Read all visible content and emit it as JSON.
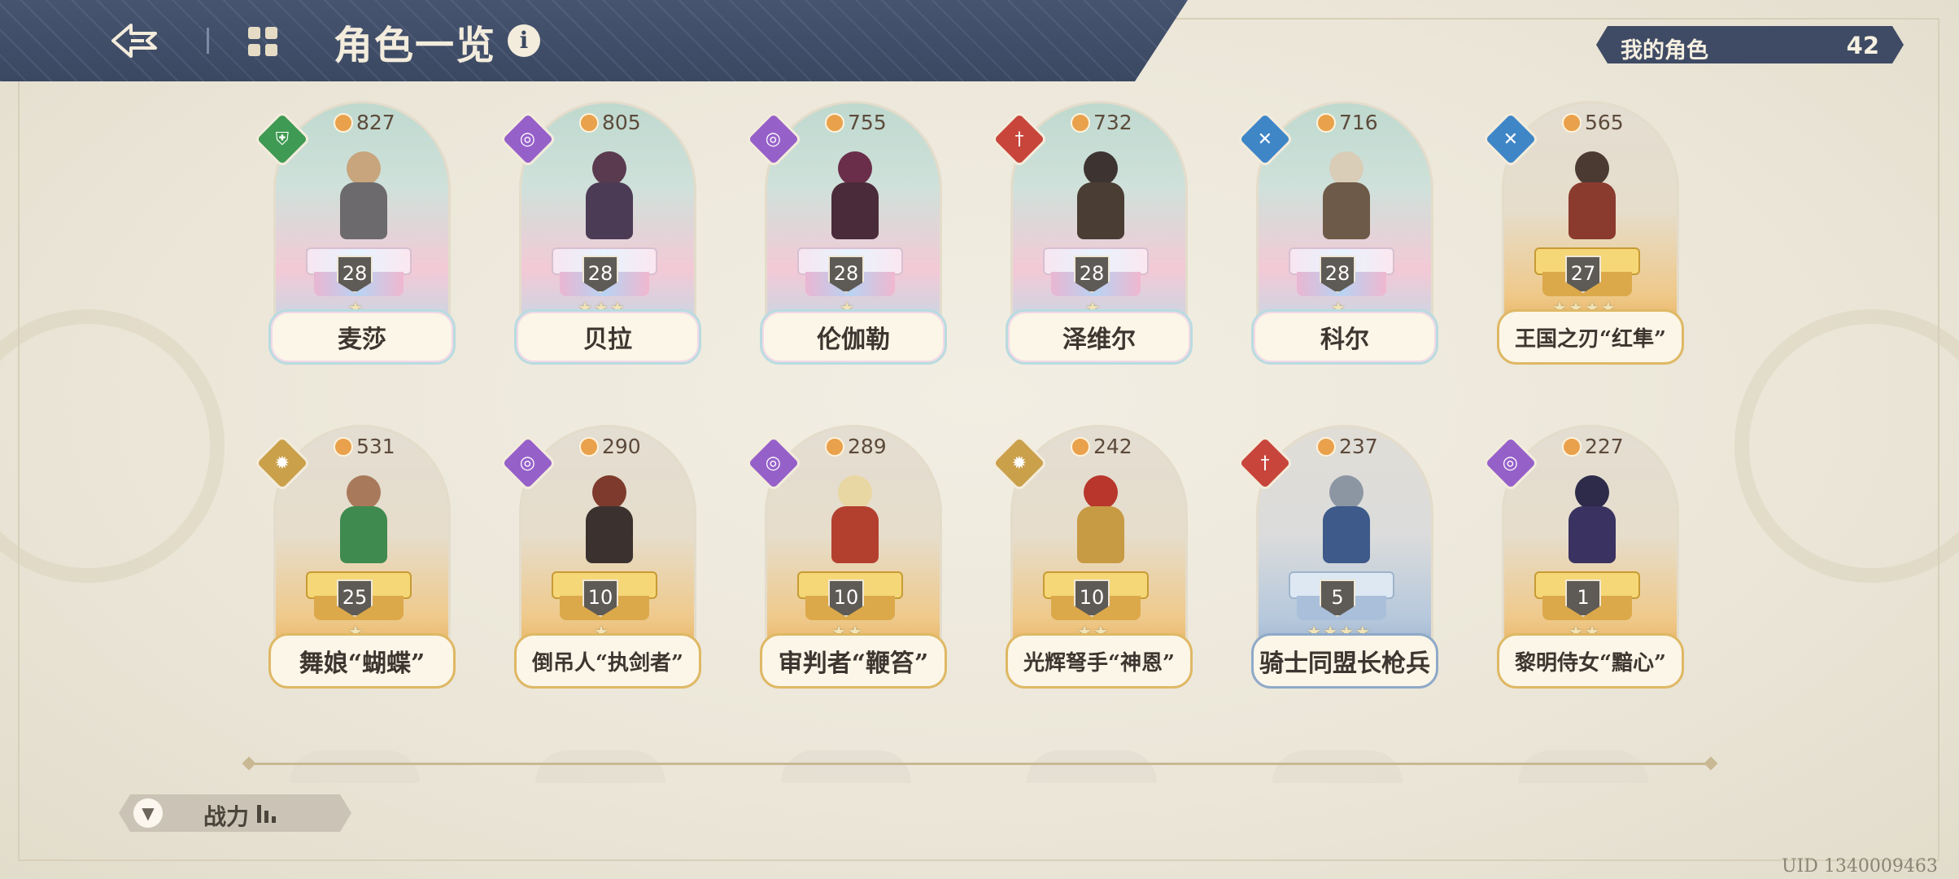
{
  "header": {
    "title": "角色一览",
    "back_icon": "back-arrow-icon",
    "grid_icon": "grid-view-icon",
    "info_icon": "info-icon"
  },
  "my_characters": {
    "label": "我的角色",
    "count": "42"
  },
  "characters": [
    {
      "name": "麦莎",
      "power": "827",
      "level": "28",
      "stars": "★",
      "element": "green-shield",
      "frame": "rainbow"
    },
    {
      "name": "贝拉",
      "power": "805",
      "level": "28",
      "stars": "★★★",
      "element": "purple-spiral",
      "frame": "rainbow"
    },
    {
      "name": "伦伽勒",
      "power": "755",
      "level": "28",
      "stars": "★",
      "element": "purple-spiral",
      "frame": "rainbow"
    },
    {
      "name": "泽维尔",
      "power": "732",
      "level": "28",
      "stars": "★",
      "element": "red-sword",
      "frame": "rainbow"
    },
    {
      "name": "科尔",
      "power": "716",
      "level": "28",
      "stars": "★",
      "element": "blue-cross",
      "frame": "rainbow"
    },
    {
      "name": "王国之刃“红隼”",
      "power": "565",
      "level": "27",
      "stars": "★★★★",
      "element": "blue-cross",
      "frame": "gold"
    },
    {
      "name": "舞娘“蝴蝶”",
      "power": "531",
      "level": "25",
      "stars": "★",
      "element": "gold-sun",
      "frame": "gold"
    },
    {
      "name": "倒吊人“执剑者”",
      "power": "290",
      "level": "10",
      "stars": "★",
      "element": "purple-spiral",
      "frame": "gold"
    },
    {
      "name": "审判者“鞭笞”",
      "power": "289",
      "level": "10",
      "stars": "★★",
      "element": "purple-spiral",
      "frame": "gold"
    },
    {
      "name": "光辉弩手“神恩”",
      "power": "242",
      "level": "10",
      "stars": "★★",
      "element": "gold-sun",
      "frame": "gold"
    },
    {
      "name": "骑士同盟长枪兵",
      "power": "237",
      "level": "5",
      "stars": "★★★★",
      "element": "red-sword",
      "frame": "blue"
    },
    {
      "name": "黎明侍女“黯心”",
      "power": "227",
      "level": "1",
      "stars": "★★",
      "element": "purple-spiral",
      "frame": "gold"
    }
  ],
  "sort": {
    "label": "战力",
    "icon": "filter-icon",
    "order_icon": "bars-descending-icon"
  },
  "uid": "UID 1340009463",
  "colors": {
    "header_bg": "#3b4862",
    "background": "#ece7da",
    "gold_frame": "#dfb865",
    "rainbow_frame": "#b9dbe0",
    "blue_frame": "#8fa9c8"
  }
}
